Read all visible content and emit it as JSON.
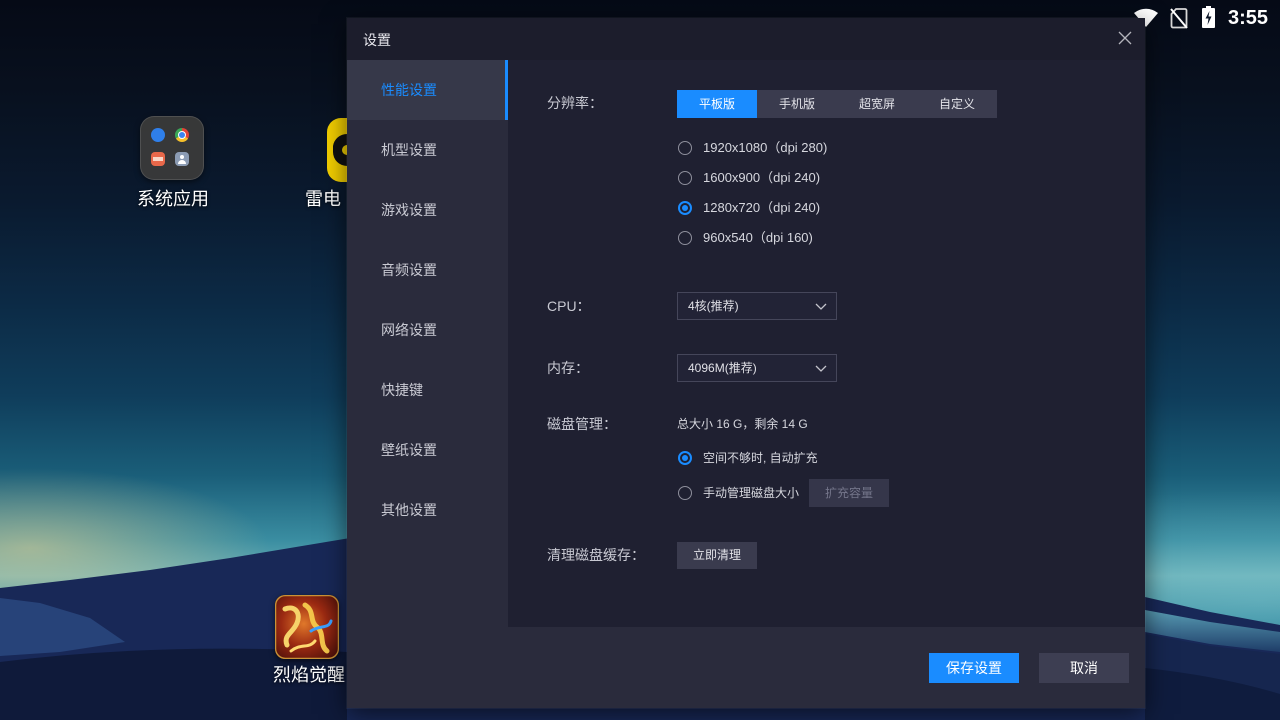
{
  "status_bar": {
    "time": "3:55",
    "icons": [
      "wifi-icon",
      "no-sim-icon",
      "battery-charging-icon"
    ]
  },
  "desktop": {
    "system_apps": {
      "label": "系统应用",
      "icon": "folder-icon"
    },
    "ld_app": {
      "label": "雷电",
      "icon": "ldplayer-icon"
    },
    "game": {
      "label": "烈焰觉醒",
      "icon": "game-icon"
    }
  },
  "dialog": {
    "title": "设置",
    "close_icon": "close-icon",
    "sidebar": [
      {
        "label": "性能设置",
        "active": true
      },
      {
        "label": "机型设置",
        "active": false
      },
      {
        "label": "游戏设置",
        "active": false
      },
      {
        "label": "音频设置",
        "active": false
      },
      {
        "label": "网络设置",
        "active": false
      },
      {
        "label": "快捷键",
        "active": false
      },
      {
        "label": "壁纸设置",
        "active": false
      },
      {
        "label": "其他设置",
        "active": false
      }
    ],
    "resolution": {
      "label": "分辨率：",
      "tabs": [
        {
          "label": "平板版",
          "active": true
        },
        {
          "label": "手机版",
          "active": false
        },
        {
          "label": "超宽屏",
          "active": false
        },
        {
          "label": "自定义",
          "active": false
        }
      ],
      "options": [
        {
          "label": "1920x1080（dpi 280)",
          "checked": false
        },
        {
          "label": "1600x900（dpi 240)",
          "checked": false
        },
        {
          "label": "1280x720（dpi 240)",
          "checked": true
        },
        {
          "label": "960x540（dpi 160)",
          "checked": false
        }
      ]
    },
    "cpu": {
      "label": "CPU：",
      "value": "4核(推荐)"
    },
    "memory": {
      "label": "内存：",
      "value": "4096M(推荐)"
    },
    "disk": {
      "label": "磁盘管理：",
      "summary": "总大小 16 G，剩余 14 G",
      "options": [
        {
          "label": "空间不够时, 自动扩充",
          "checked": true
        },
        {
          "label": "手动管理磁盘大小",
          "checked": false
        }
      ],
      "expand_button": "扩充容量"
    },
    "cache": {
      "label": "清理磁盘缓存：",
      "button": "立即清理"
    },
    "footer": {
      "save": "保存设置",
      "cancel": "取消"
    }
  },
  "colors": {
    "accent": "#1a8cff",
    "title_bg": "#1c1d2c",
    "dialog_bg": "#1f2031",
    "sidebar_bg": "#2a2b3c",
    "sidebar_active": "#363849",
    "footer_bg": "#2a2b3c"
  }
}
